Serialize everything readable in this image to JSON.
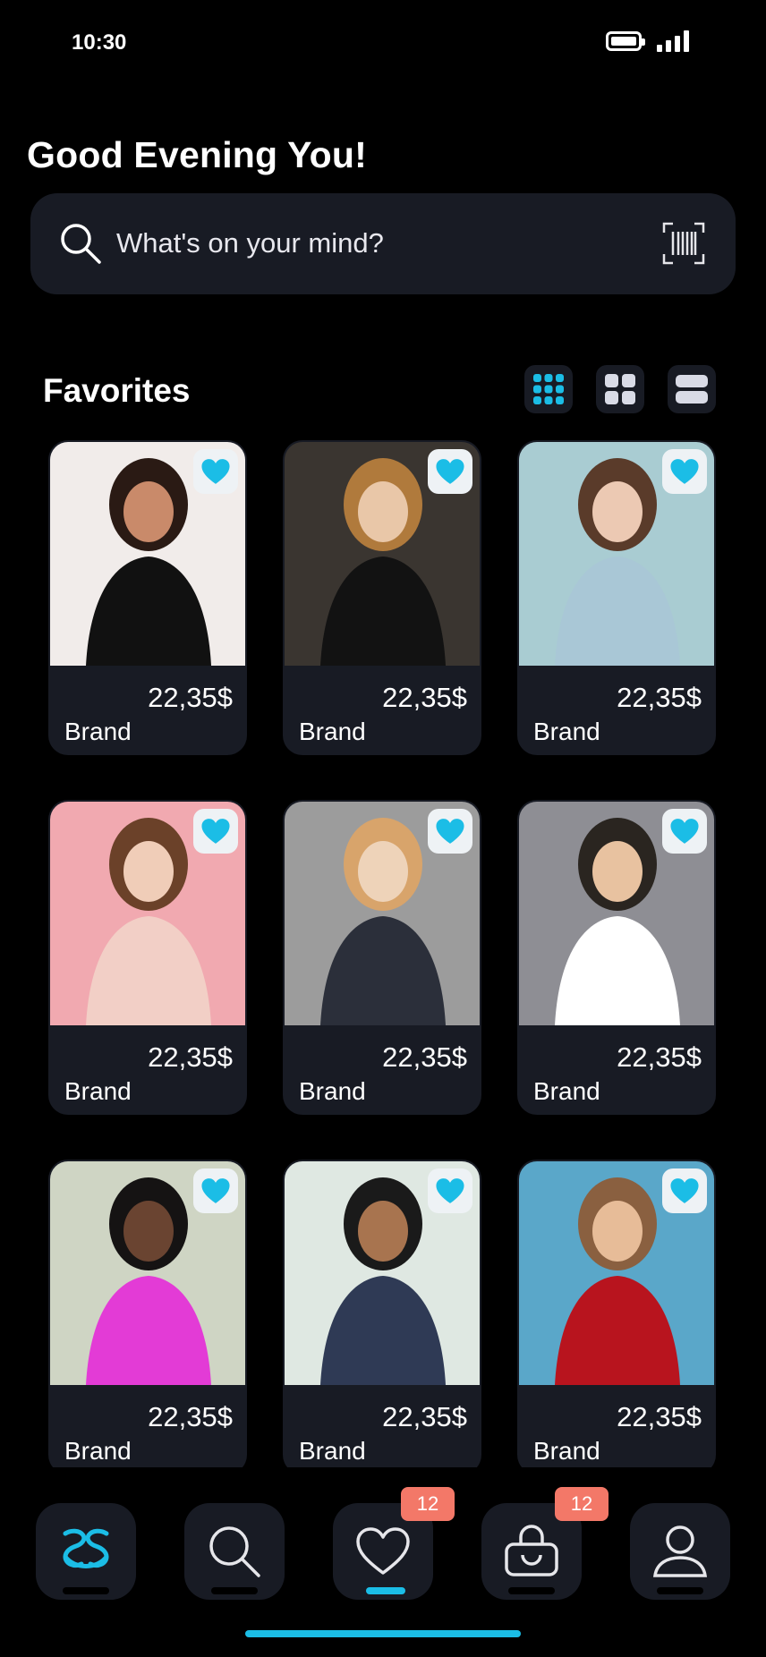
{
  "status_bar": {
    "time": "10:30"
  },
  "header": {
    "greeting": "Good Evening You!"
  },
  "search": {
    "placeholder": "What's on your mind?"
  },
  "favorites": {
    "title": "Favorites",
    "view_modes": [
      "grid-3-icon",
      "grid-2-icon",
      "list-icon"
    ],
    "active_view": "grid-3-icon",
    "items": [
      {
        "price": "22,35$",
        "brand": "Brand",
        "favorited": true
      },
      {
        "price": "22,35$",
        "brand": "Brand",
        "favorited": true
      },
      {
        "price": "22,35$",
        "brand": "Brand",
        "favorited": true
      },
      {
        "price": "22,35$",
        "brand": "Brand",
        "favorited": true
      },
      {
        "price": "22,35$",
        "brand": "Brand",
        "favorited": true
      },
      {
        "price": "22,35$",
        "brand": "Brand",
        "favorited": true
      },
      {
        "price": "22,35$",
        "brand": "Brand",
        "favorited": true
      },
      {
        "price": "22,35$",
        "brand": "Brand",
        "favorited": true
      },
      {
        "price": "22,35$",
        "brand": "Brand",
        "favorited": true
      }
    ]
  },
  "tab_bar": {
    "tabs": [
      {
        "icon": "logo-icon",
        "active": false
      },
      {
        "icon": "search-icon",
        "active": false
      },
      {
        "icon": "heart-icon",
        "active": true,
        "badge": "12"
      },
      {
        "icon": "shopping-bag-icon",
        "active": false,
        "badge": "12"
      },
      {
        "icon": "profile-icon",
        "active": false
      }
    ]
  },
  "colors": {
    "background": "#000000",
    "surface": "#181b24",
    "accent": "#1bbde6",
    "badge": "#f37868"
  }
}
